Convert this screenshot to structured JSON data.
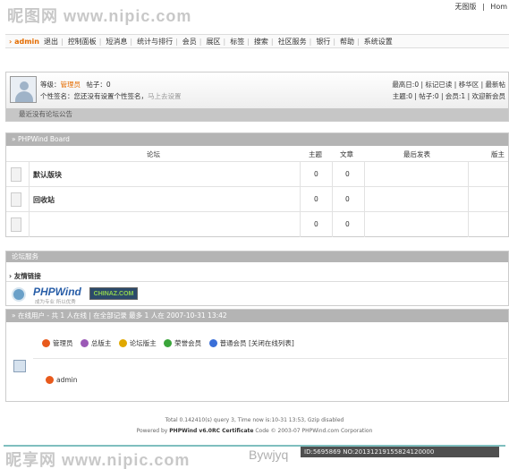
{
  "watermark": {
    "top": "昵图网 www.nipic.com",
    "bottom_left": "昵享网 www.nipic.com",
    "bottom_right": "Bywjyq",
    "image_id": "ID:5695869 NO:20131219155824120000"
  },
  "topbar": {
    "links": [
      "无图版",
      "Hom"
    ]
  },
  "nav": {
    "user": "› admin",
    "items": [
      "退出",
      "控制面板",
      "短消息",
      "统计与排行",
      "会员",
      "展区",
      "标签",
      "搜索",
      "社区服务",
      "银行",
      "帮助",
      "系统设置"
    ]
  },
  "user": {
    "level_label": "等级：",
    "level_value": "管理员",
    "posts_label": "帖子：0",
    "signature_label": "个性签名：您还没有设置个性签名，",
    "signature_link": "马上去设置",
    "right_line1": "最高日:0 | 标记已读 | 移华区 | 最新帖",
    "right_line2": "主题:0 | 帖子:0 | 会员:1 | 欢迎新会员",
    "notice": "最近没有论坛公告"
  },
  "board": {
    "title": "» PHPWind Board",
    "headers": [
      "论坛",
      "主题",
      "文章",
      "最后发表",
      "版主"
    ],
    "rows": [
      {
        "name": "默认版块",
        "topics": "0",
        "posts": "0"
      },
      {
        "name": "回收站",
        "topics": "0",
        "posts": "0"
      },
      {
        "name": "",
        "topics": "0",
        "posts": "0"
      }
    ]
  },
  "links": {
    "title": "论坛服务",
    "subtitle": "› 友情链接",
    "logo1": "PHPWind",
    "logo1_sub": "成为专业 所以优秀",
    "logo2": "CHINAZ.COM"
  },
  "online": {
    "title": "» 在线用户 - 共 1 人在线 | 在全部记录 最多 1 人在 2007-10-31 13:42",
    "legend": [
      "管理员",
      "总版主",
      "论坛版主",
      "荣誉会员",
      "普通会员 [关闭在线列表]"
    ],
    "legend_colors": [
      "#e85a1c",
      "#9b59b6",
      "#e0a800",
      "#3aa53a",
      "#3a6fd8"
    ],
    "users": [
      "admin"
    ]
  },
  "footer": {
    "line1": "Total 0.142410(s) query 3, Time now is:10-31 13:53, Gzip disabled",
    "line2_prefix": "Powered by",
    "line2_brand": "PHPWind v6.0RC Certificate",
    "line2_suffix": "Code © 2003-07 PHPWind.com Corporation"
  }
}
